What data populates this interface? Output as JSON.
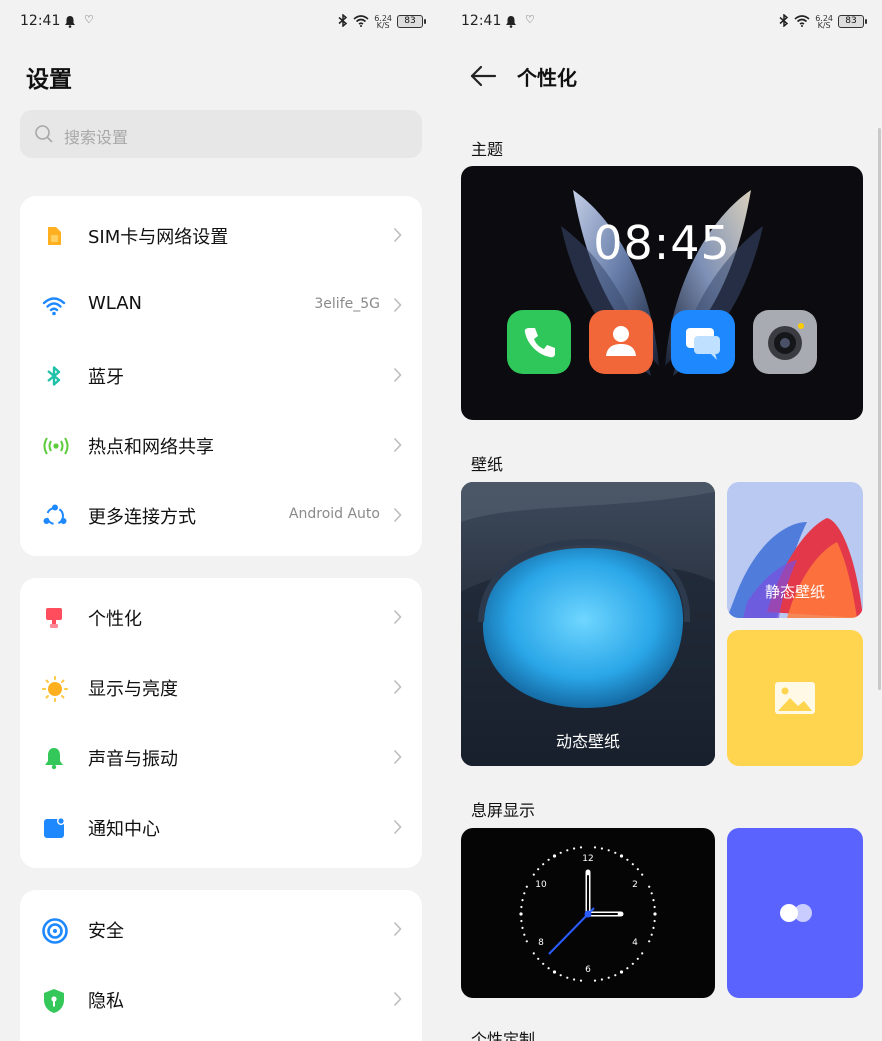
{
  "status_bar": {
    "time": "12:41",
    "speed_value": "6.24",
    "speed_unit": "K/S",
    "battery": "83"
  },
  "settings": {
    "title": "设置",
    "search_placeholder": "搜索设置",
    "groups": [
      {
        "items": [
          {
            "label": "SIM卡与网络设置",
            "value": "",
            "icon": "sim-card-icon"
          },
          {
            "label": "WLAN",
            "value": "3elife_5G",
            "icon": "wifi-icon"
          },
          {
            "label": "蓝牙",
            "value": "",
            "icon": "bluetooth-icon"
          },
          {
            "label": "热点和网络共享",
            "value": "",
            "icon": "hotspot-icon"
          },
          {
            "label": "更多连接方式",
            "value": "Android Auto",
            "icon": "connection-icon"
          }
        ]
      },
      {
        "items": [
          {
            "label": "个性化",
            "value": "",
            "icon": "personalize-icon"
          },
          {
            "label": "显示与亮度",
            "value": "",
            "icon": "sun-icon"
          },
          {
            "label": "声音与振动",
            "value": "",
            "icon": "bell-icon"
          },
          {
            "label": "通知中心",
            "value": "",
            "icon": "notification-icon"
          }
        ]
      },
      {
        "items": [
          {
            "label": "安全",
            "value": "",
            "icon": "security-icon"
          },
          {
            "label": "隐私",
            "value": "",
            "icon": "privacy-icon"
          }
        ]
      }
    ]
  },
  "personalize": {
    "title": "个性化",
    "theme_section": "主题",
    "theme_clock": "08:45",
    "wallpaper_section": "壁纸",
    "live_wallpaper": "动态壁纸",
    "static_wallpaper": "静态壁纸",
    "aod_section": "息屏显示",
    "aod_clock_numbers": [
      "12",
      "2",
      "4",
      "6",
      "8",
      "10"
    ],
    "custom_section": "个性定制"
  },
  "colors": {
    "accent_blue": "#1e88ff",
    "theme_bg": "#0c0c10",
    "gallery_tile": "#ffd54f",
    "aod_tile": "#5b63ff"
  }
}
